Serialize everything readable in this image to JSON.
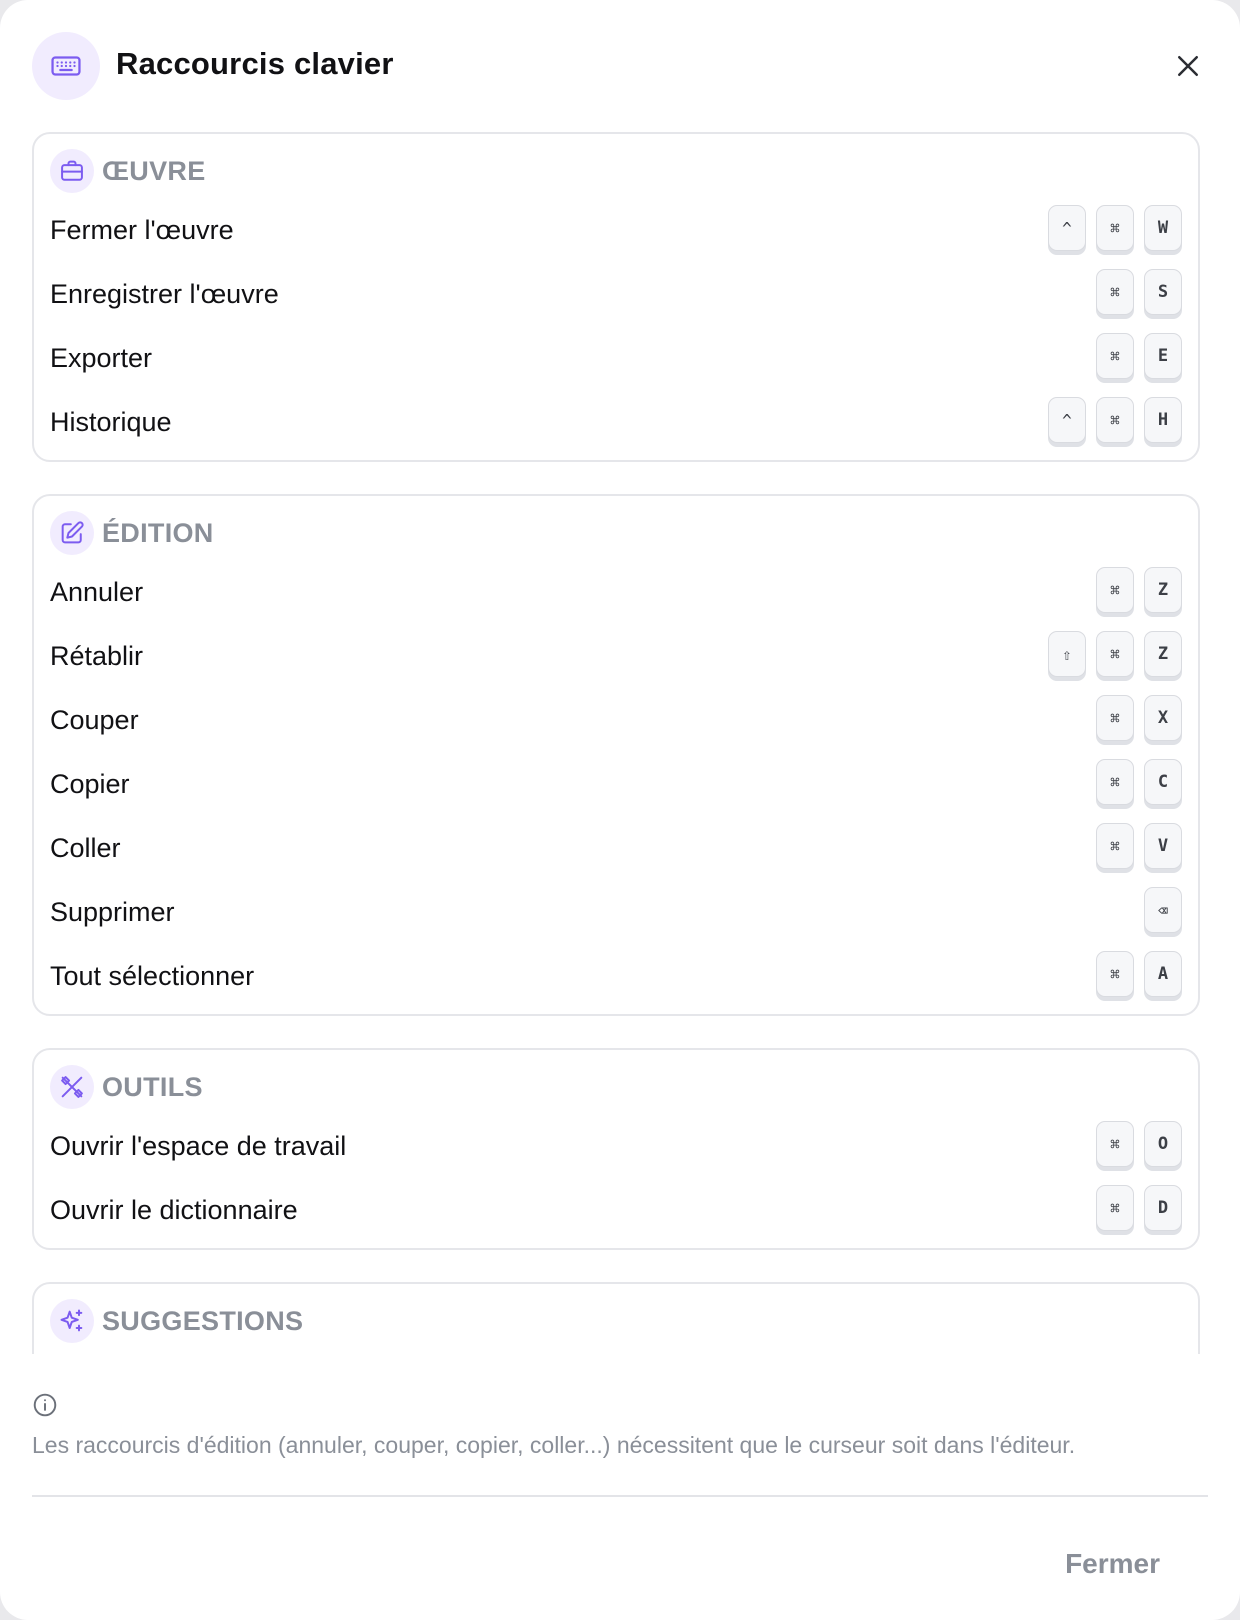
{
  "dialog": {
    "title": "Raccourcis clavier",
    "header_icon": "keyboard-icon",
    "close_icon": "close-icon"
  },
  "sections": [
    {
      "id": "oeuvre",
      "title": "ŒUVRE",
      "icon": "briefcase-icon",
      "rows": [
        {
          "label": "Fermer l'œuvre",
          "keys": [
            "^",
            "⌘",
            "W"
          ]
        },
        {
          "label": "Enregistrer l'œuvre",
          "keys": [
            "⌘",
            "S"
          ]
        },
        {
          "label": "Exporter",
          "keys": [
            "⌘",
            "E"
          ]
        },
        {
          "label": "Historique",
          "keys": [
            "^",
            "⌘",
            "H"
          ]
        }
      ]
    },
    {
      "id": "edition",
      "title": "ÉDITION",
      "icon": "edit-icon",
      "rows": [
        {
          "label": "Annuler",
          "keys": [
            "⌘",
            "Z"
          ]
        },
        {
          "label": "Rétablir",
          "keys": [
            "⇧",
            "⌘",
            "Z"
          ]
        },
        {
          "label": "Couper",
          "keys": [
            "⌘",
            "X"
          ]
        },
        {
          "label": "Copier",
          "keys": [
            "⌘",
            "C"
          ]
        },
        {
          "label": "Coller",
          "keys": [
            "⌘",
            "V"
          ]
        },
        {
          "label": "Supprimer",
          "keys": [
            "⌫"
          ]
        },
        {
          "label": "Tout sélectionner",
          "keys": [
            "⌘",
            "A"
          ]
        }
      ]
    },
    {
      "id": "outils",
      "title": "OUTILS",
      "icon": "tools-icon",
      "rows": [
        {
          "label": "Ouvrir l'espace de travail",
          "keys": [
            "⌘",
            "O"
          ]
        },
        {
          "label": "Ouvrir le dictionnaire",
          "keys": [
            "⌘",
            "D"
          ]
        }
      ]
    },
    {
      "id": "suggestions",
      "title": "SUGGESTIONS",
      "icon": "sparkles-icon",
      "rows": []
    }
  ],
  "info": {
    "icon": "info-icon",
    "text": "Les raccourcis d'édition (annuler, couper, copier, coller...) nécessitent que le curseur soit dans l'éditeur."
  },
  "footer": {
    "close_label": "Fermer"
  },
  "colors": {
    "accent": "#7c5cf0",
    "icon_bg": "#f1ecfe",
    "muted_text": "#8a8f98",
    "border": "#e5e6ea"
  }
}
